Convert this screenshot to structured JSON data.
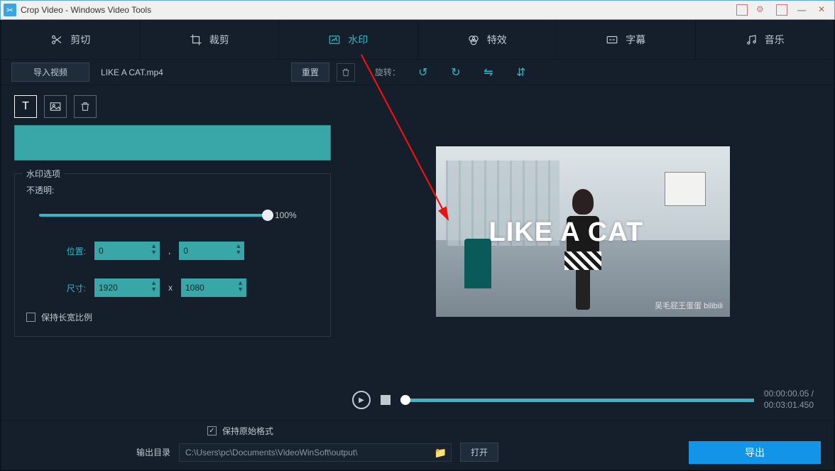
{
  "titlebar": {
    "title": "Crop Video - Windows Video Tools"
  },
  "tabs": {
    "cut": "剪切",
    "crop": "裁剪",
    "watermark": "水印",
    "effects": "特效",
    "subtitle": "字幕",
    "music": "音乐"
  },
  "toolbar": {
    "import": "导入视频",
    "filename": "LIKE A CAT.mp4",
    "reset": "重置",
    "rotate_label": "旋转："
  },
  "watermark": {
    "options_legend": "水印选项",
    "opacity_label": "不透明:",
    "opacity_value": "100%",
    "position_label": "位置:",
    "pos_x": "0",
    "pos_y": "0",
    "size_label": "尺寸:",
    "size_w": "1920",
    "size_h": "1080",
    "comma": ",",
    "x_sep": "x",
    "keep_ratio": "保持长宽比例"
  },
  "preview": {
    "overlay_text": "LIKE A CAT",
    "credit": "吴毛屁王蛋蛋  bilibili"
  },
  "player": {
    "current": "00:00:00.05",
    "total": "00:03:01.450",
    "sep": " / "
  },
  "bottom": {
    "keep_format": "保持原始格式",
    "output_label": "输出目录",
    "output_path": "C:\\Users\\pc\\Documents\\VideoWinSoft\\output\\",
    "open": "打开",
    "export": "导出"
  }
}
